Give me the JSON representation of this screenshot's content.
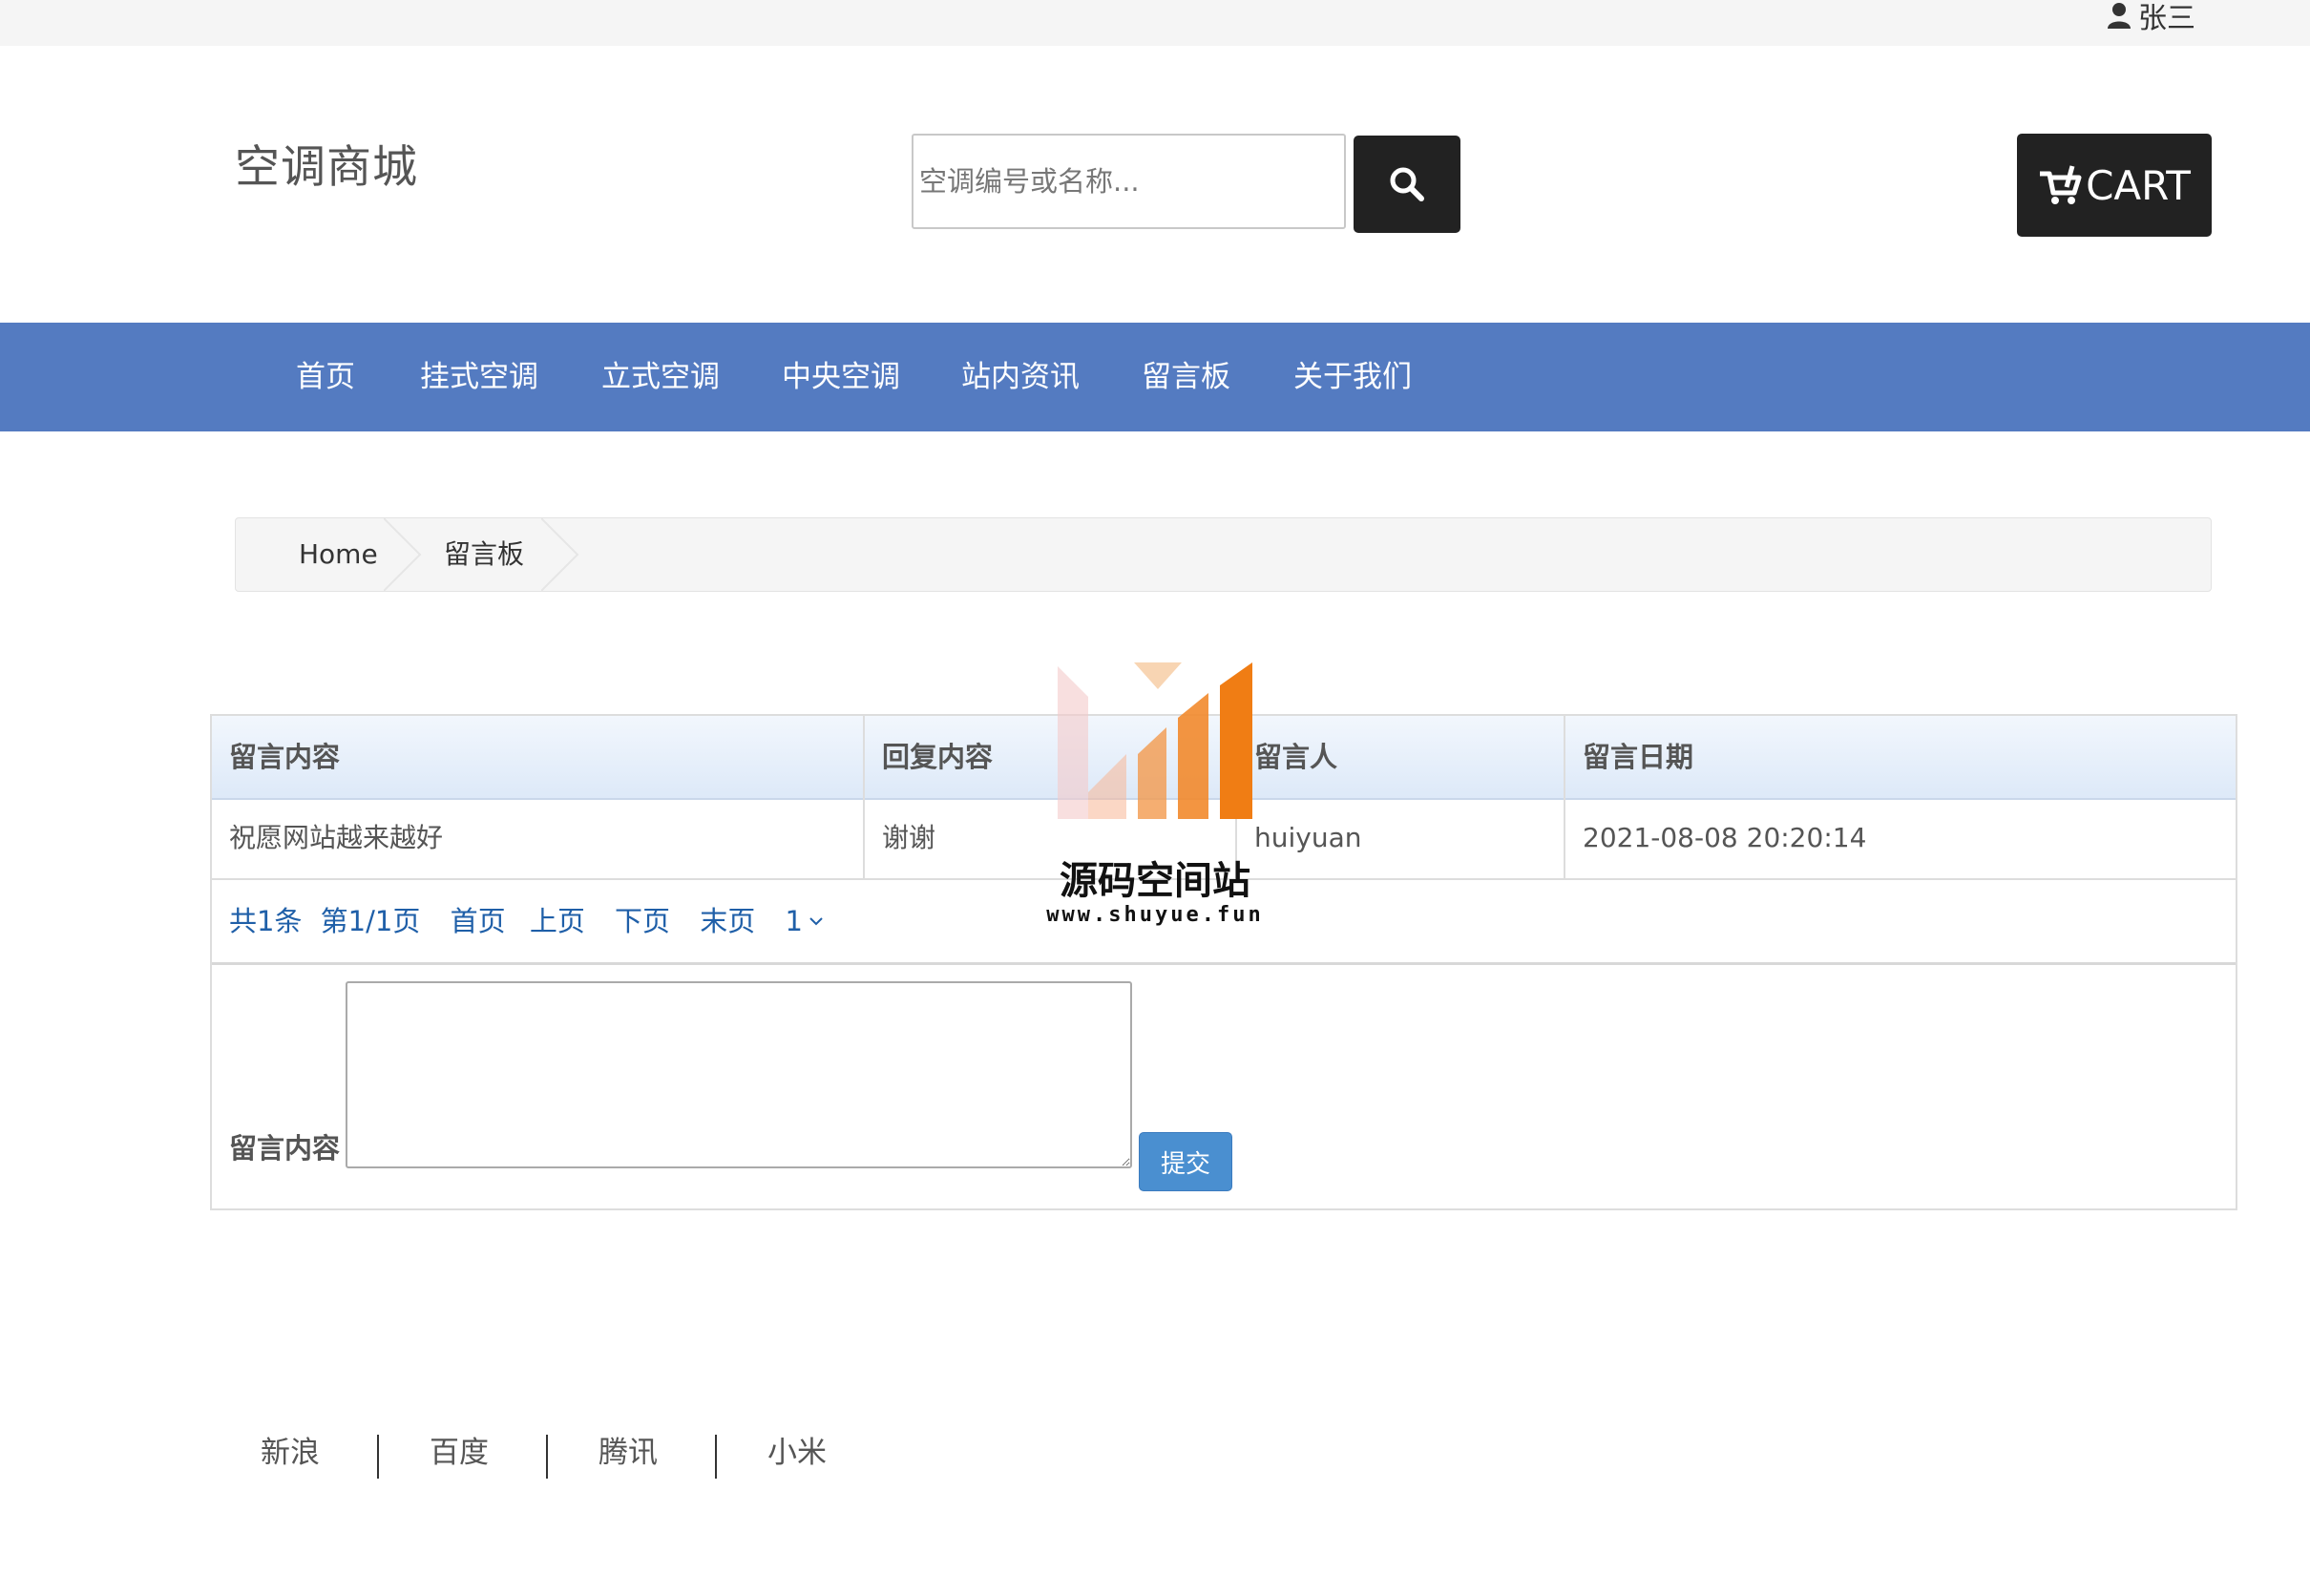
{
  "topbar": {
    "user_name": "张三",
    "user_icon": "user-icon"
  },
  "header": {
    "logo": "空调商城",
    "search_placeholder": "空调编号或名称...",
    "search_icon": "search-icon",
    "cart_label": "CART",
    "cart_icon": "cart-icon"
  },
  "nav": {
    "items": [
      {
        "label": "首页"
      },
      {
        "label": "挂式空调"
      },
      {
        "label": "立式空调"
      },
      {
        "label": "中央空调"
      },
      {
        "label": "站内资讯"
      },
      {
        "label": "留言板"
      },
      {
        "label": "关于我们"
      }
    ]
  },
  "breadcrumb": {
    "items": [
      {
        "label": "Home"
      },
      {
        "label": "留言板"
      }
    ]
  },
  "table": {
    "headers": [
      "留言内容",
      "回复内容",
      "留言人",
      "留言日期"
    ],
    "rows": [
      [
        "祝愿网站越来越好",
        "谢谢",
        "huiyuan",
        "2021-08-08 20:20:14"
      ]
    ]
  },
  "pager": {
    "total": "共1条",
    "page_info": "第1/1页",
    "first": "首页",
    "prev": "上页",
    "next": "下页",
    "last": "末页",
    "current_select": "1"
  },
  "form": {
    "label": "留言内容",
    "textarea_value": "",
    "submit_label": "提交"
  },
  "footer": {
    "links": [
      "新浪",
      "百度",
      "腾讯",
      "小米"
    ]
  },
  "watermark": {
    "title": "源码空间站",
    "url": "www.shuyue.fun"
  },
  "colors": {
    "nav_bg": "#547bc1",
    "dark_button": "#222222",
    "submit_button": "#4a8fd0",
    "link": "#1f5fa8"
  }
}
